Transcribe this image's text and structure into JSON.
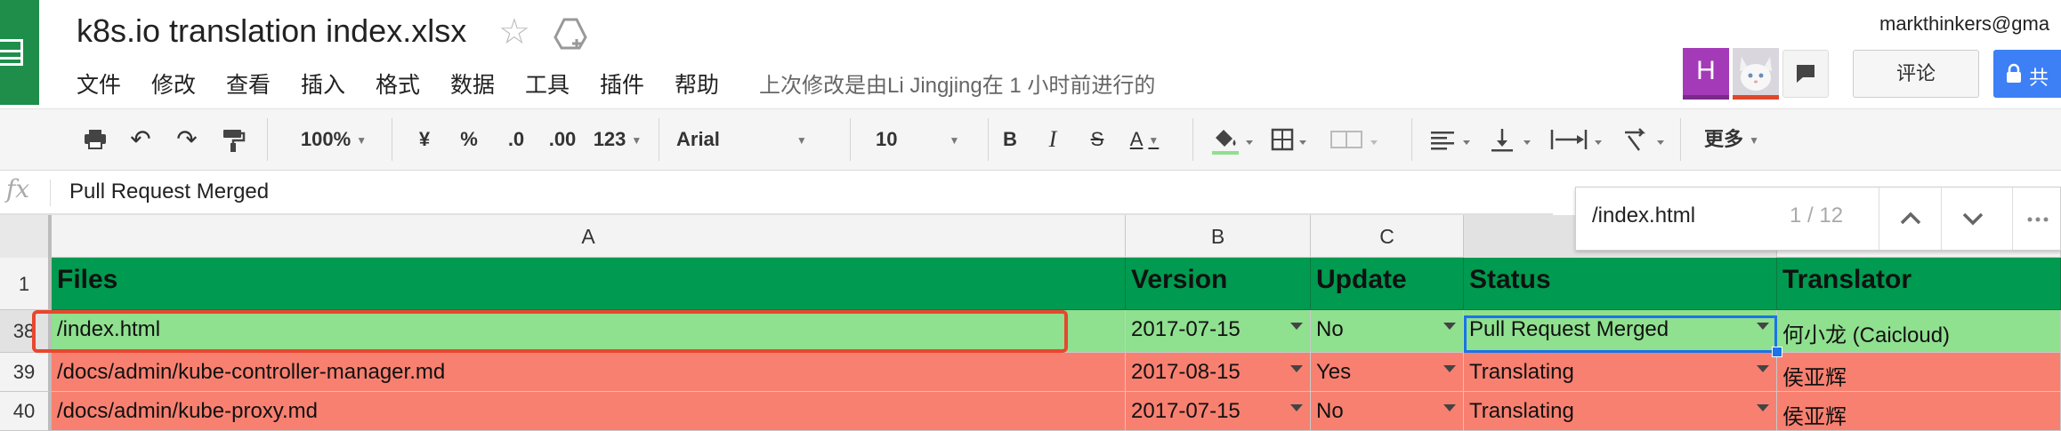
{
  "app": {
    "doc_title": "k8s.io translation index.xlsx",
    "account_email": "markthinkers@gma",
    "last_edit": "上次修改是由Li Jingjing在 1 小时前进行的",
    "menu": [
      "文件",
      "修改",
      "查看",
      "插入",
      "格式",
      "数据",
      "工具",
      "插件",
      "帮助"
    ],
    "avatar_letter": "H",
    "comment_label": "评论",
    "share_label": "共"
  },
  "toolbar": {
    "zoom": "100%",
    "currency": "¥",
    "percent": "%",
    "decrease_decimals": ".0",
    "increase_decimals": ".00",
    "more_formats": "123",
    "font": "Arial",
    "font_size": "10",
    "bold": "B",
    "italic": "I",
    "strike": "S",
    "text_color": "A",
    "more": "更多"
  },
  "formula_bar": {
    "fx": "fx",
    "value": "Pull Request Merged"
  },
  "find": {
    "query": "/index.html",
    "count": "1 / 12"
  },
  "grid": {
    "columns": [
      "A",
      "B",
      "C"
    ],
    "header_row": {
      "num": "1",
      "cells": [
        "Files",
        "Version",
        "Update",
        "Status",
        "Translator"
      ]
    },
    "rows": [
      {
        "num": "38",
        "cells": [
          "/index.html",
          "2017-07-15",
          "No",
          "Pull Request Merged",
          "何小龙 (Caicloud)"
        ]
      },
      {
        "num": "39",
        "cells": [
          "/docs/admin/kube-controller-manager.md",
          "2017-08-15",
          "Yes",
          "Translating",
          "侯亚辉"
        ]
      },
      {
        "num": "40",
        "cells": [
          "/docs/admin/kube-proxy.md",
          "2017-07-15",
          "No",
          "Translating",
          "侯亚辉"
        ]
      }
    ]
  },
  "colors": {
    "header_green": "#009a50",
    "done_green": "#8fe08f",
    "translating_red": "#f88070",
    "highlight_red": "#e8472f",
    "selection_blue": "#1a73e8"
  }
}
